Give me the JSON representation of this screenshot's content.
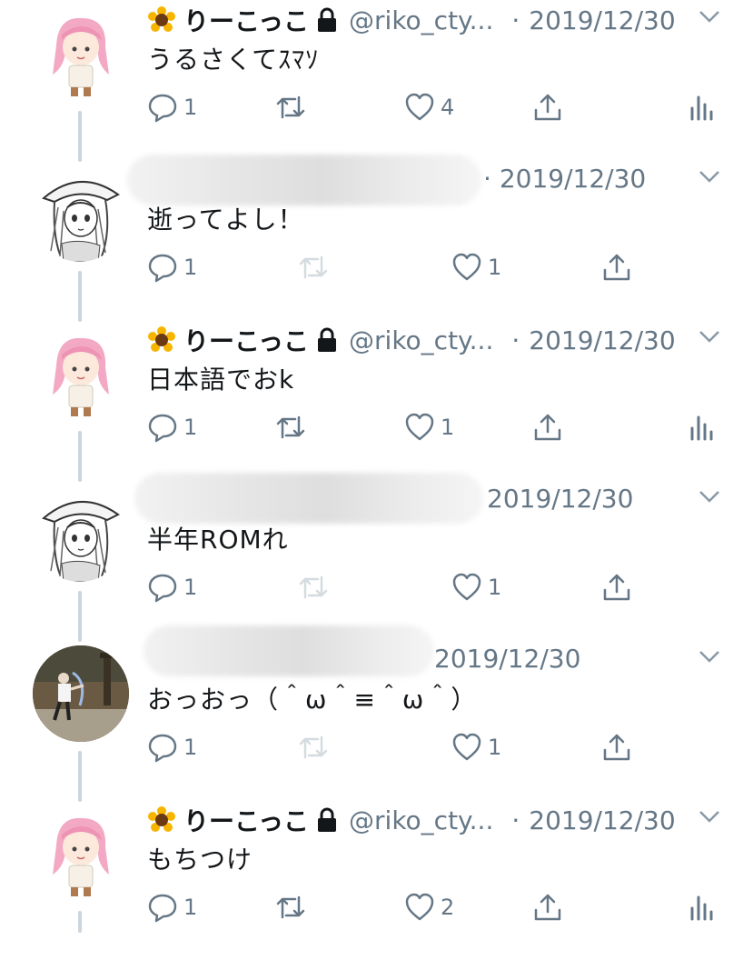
{
  "tweets": [
    {
      "author": "own",
      "display_name": "りーこっこ",
      "handle": "@riko_cty...",
      "date": "2019/12/30",
      "text": "うるさくてｽﾏｿ",
      "avatar": "pink-hair-avatar",
      "reply_count": "1",
      "like_count": "4",
      "has_analytics": true
    },
    {
      "author": "hidden",
      "date": "2019/12/30",
      "text": "逝ってよし！",
      "avatar": "sketch-avatar",
      "reply_count": "1",
      "like_count": "1",
      "has_analytics": false
    },
    {
      "author": "own",
      "display_name": "りーこっこ",
      "handle": "@riko_cty...",
      "date": "2019/12/30",
      "text": "日本語でおk",
      "avatar": "pink-hair-avatar",
      "reply_count": "1",
      "like_count": "1",
      "has_analytics": true
    },
    {
      "author": "hidden",
      "date": "2019/12/30",
      "text": "半年ROMれ",
      "avatar": "sketch-avatar",
      "reply_count": "1",
      "like_count": "1",
      "has_analytics": false
    },
    {
      "author": "hidden",
      "date": "2019/12/30",
      "text": "おっおっ（＾ω＾≡＾ω＾）",
      "avatar": "game-screenshot-avatar",
      "reply_count": "1",
      "like_count": "1",
      "has_analytics": false
    },
    {
      "author": "own",
      "display_name": "りーこっこ",
      "handle": "@riko_cty...",
      "date": "2019/12/30",
      "text": "もちつけ",
      "avatar": "pink-hair-avatar",
      "reply_count": "1",
      "like_count": "2",
      "has_analytics": true
    }
  ],
  "icons": {
    "reply": "reply-icon",
    "retweet": "retweet-icon",
    "like": "heart-icon",
    "share": "share-icon",
    "analytics": "analytics-icon",
    "caret": "chevron-down-icon",
    "badge": "sunflower-icon",
    "protected": "lock-icon"
  },
  "colors": {
    "text": "#14171a",
    "secondary": "#657786",
    "thread_line": "#ccd6dd",
    "background": "#ffffff"
  }
}
